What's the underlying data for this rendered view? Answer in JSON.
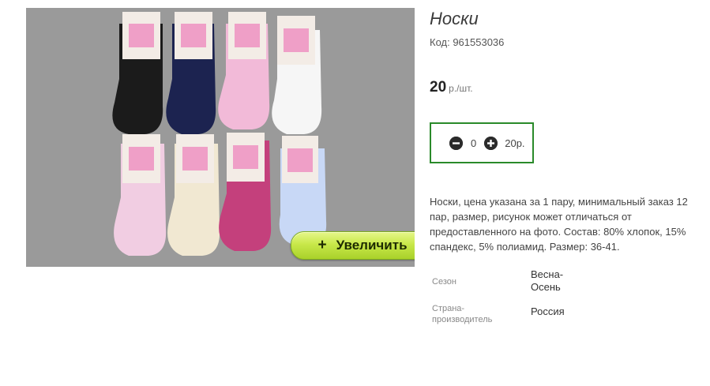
{
  "product": {
    "title": "Носки",
    "code_text": "Код: 961553036",
    "price_amount": "20",
    "price_unit": "р./шт.",
    "description": "Носки, цена указана за 1 пару, минимальный заказ 12 пар, размер, рисунок может отличаться от предоставленного на фото. Состав: 80% хлопок, 15% спандекс, 5% полиамид. Размер: 36-41."
  },
  "image": {
    "zoom_plus": "+",
    "zoom_label": "Увеличить",
    "colors": {
      "background": "#9a9a9a",
      "sock_black": "#1b1b1b",
      "sock_navy": "#1c2350",
      "sock_pink": "#f2bad8",
      "sock_white": "#f6f6f6",
      "sock_lightpink": "#f1cde2",
      "sock_cream": "#f1e8d2",
      "sock_magenta": "#c4407c",
      "sock_lightblue": "#c8d8f6"
    }
  },
  "quantity": {
    "minus_icon": "minus-circle-icon",
    "plus_icon": "plus-circle-icon",
    "value": "0",
    "sum": "20р.",
    "border_color": "#2a8a2a"
  },
  "properties": [
    {
      "key": "Сезон",
      "value_line1": "Весна-",
      "value_line2": "Осень"
    },
    {
      "key_line1": "Страна-",
      "key_line2": "производитель",
      "value": "Россия"
    }
  ]
}
